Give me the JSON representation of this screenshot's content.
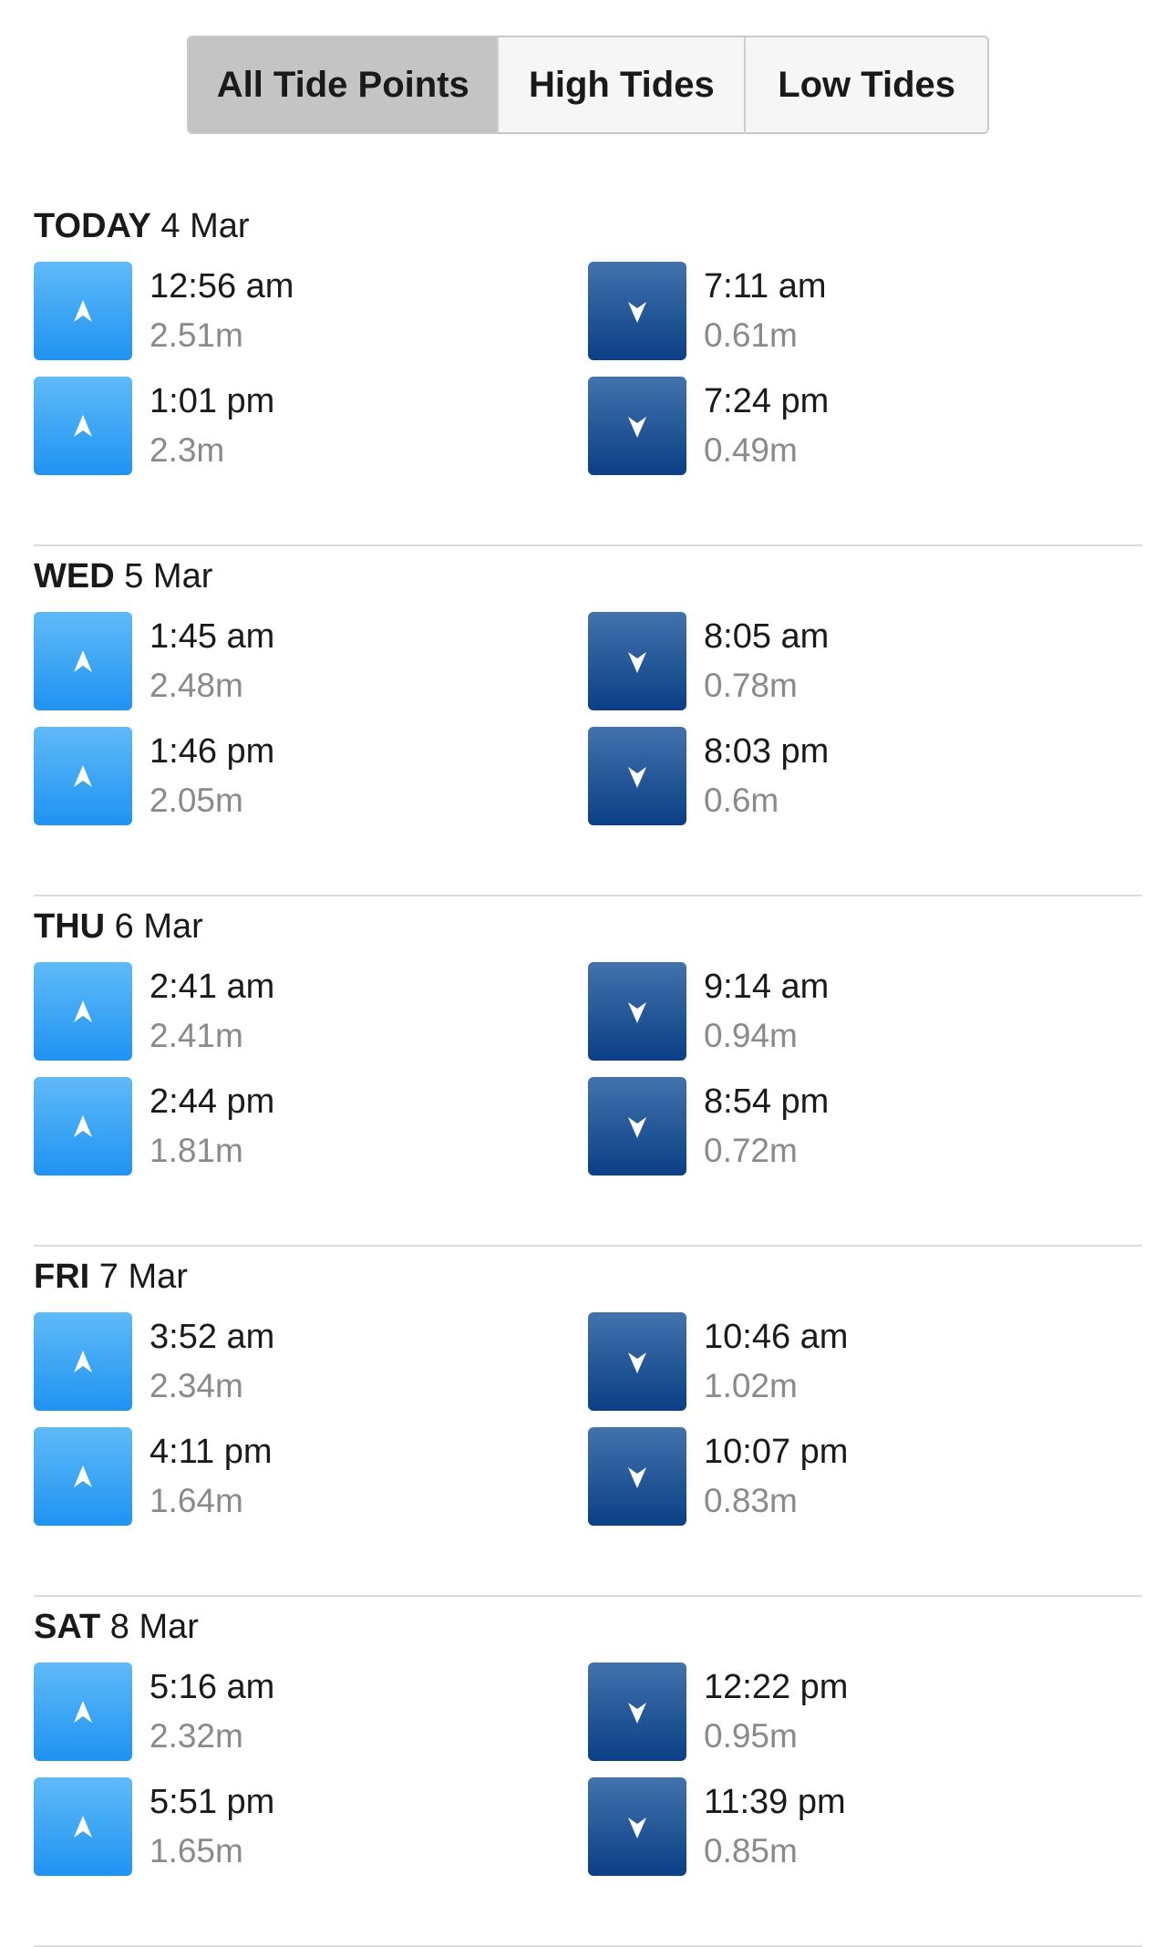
{
  "filter": {
    "options": [
      "All Tide Points",
      "High Tides",
      "Low Tides"
    ],
    "selected": "All Tide Points"
  },
  "colors": {
    "high_icon": "#2A9BF4",
    "low_icon": "#1A4E93",
    "active_tab": "#C4C4C4"
  },
  "days": [
    {
      "label": "TODAY",
      "date": "4 Mar",
      "tides": [
        {
          "type": "high",
          "icon": "arrow-up-icon",
          "time": "12:56 am",
          "height": "2.51m"
        },
        {
          "type": "low",
          "icon": "arrow-down-icon",
          "time": "7:11 am",
          "height": "0.61m"
        },
        {
          "type": "high",
          "icon": "arrow-up-icon",
          "time": "1:01 pm",
          "height": "2.3m"
        },
        {
          "type": "low",
          "icon": "arrow-down-icon",
          "time": "7:24 pm",
          "height": "0.49m"
        }
      ]
    },
    {
      "label": "WED",
      "date": "5 Mar",
      "tides": [
        {
          "type": "high",
          "icon": "arrow-up-icon",
          "time": "1:45 am",
          "height": "2.48m"
        },
        {
          "type": "low",
          "icon": "arrow-down-icon",
          "time": "8:05 am",
          "height": "0.78m"
        },
        {
          "type": "high",
          "icon": "arrow-up-icon",
          "time": "1:46 pm",
          "height": "2.05m"
        },
        {
          "type": "low",
          "icon": "arrow-down-icon",
          "time": "8:03 pm",
          "height": "0.6m"
        }
      ]
    },
    {
      "label": "THU",
      "date": "6 Mar",
      "tides": [
        {
          "type": "high",
          "icon": "arrow-up-icon",
          "time": "2:41 am",
          "height": "2.41m"
        },
        {
          "type": "low",
          "icon": "arrow-down-icon",
          "time": "9:14 am",
          "height": "0.94m"
        },
        {
          "type": "high",
          "icon": "arrow-up-icon",
          "time": "2:44 pm",
          "height": "1.81m"
        },
        {
          "type": "low",
          "icon": "arrow-down-icon",
          "time": "8:54 pm",
          "height": "0.72m"
        }
      ]
    },
    {
      "label": "FRI",
      "date": "7 Mar",
      "tides": [
        {
          "type": "high",
          "icon": "arrow-up-icon",
          "time": "3:52 am",
          "height": "2.34m"
        },
        {
          "type": "low",
          "icon": "arrow-down-icon",
          "time": "10:46 am",
          "height": "1.02m"
        },
        {
          "type": "high",
          "icon": "arrow-up-icon",
          "time": "4:11 pm",
          "height": "1.64m"
        },
        {
          "type": "low",
          "icon": "arrow-down-icon",
          "time": "10:07 pm",
          "height": "0.83m"
        }
      ]
    },
    {
      "label": "SAT",
      "date": "8 Mar",
      "tides": [
        {
          "type": "high",
          "icon": "arrow-up-icon",
          "time": "5:16 am",
          "height": "2.32m"
        },
        {
          "type": "low",
          "icon": "arrow-down-icon",
          "time": "12:22 pm",
          "height": "0.95m"
        },
        {
          "type": "high",
          "icon": "arrow-up-icon",
          "time": "5:51 pm",
          "height": "1.65m"
        },
        {
          "type": "low",
          "icon": "arrow-down-icon",
          "time": "11:39 pm",
          "height": "0.85m"
        }
      ]
    }
  ]
}
